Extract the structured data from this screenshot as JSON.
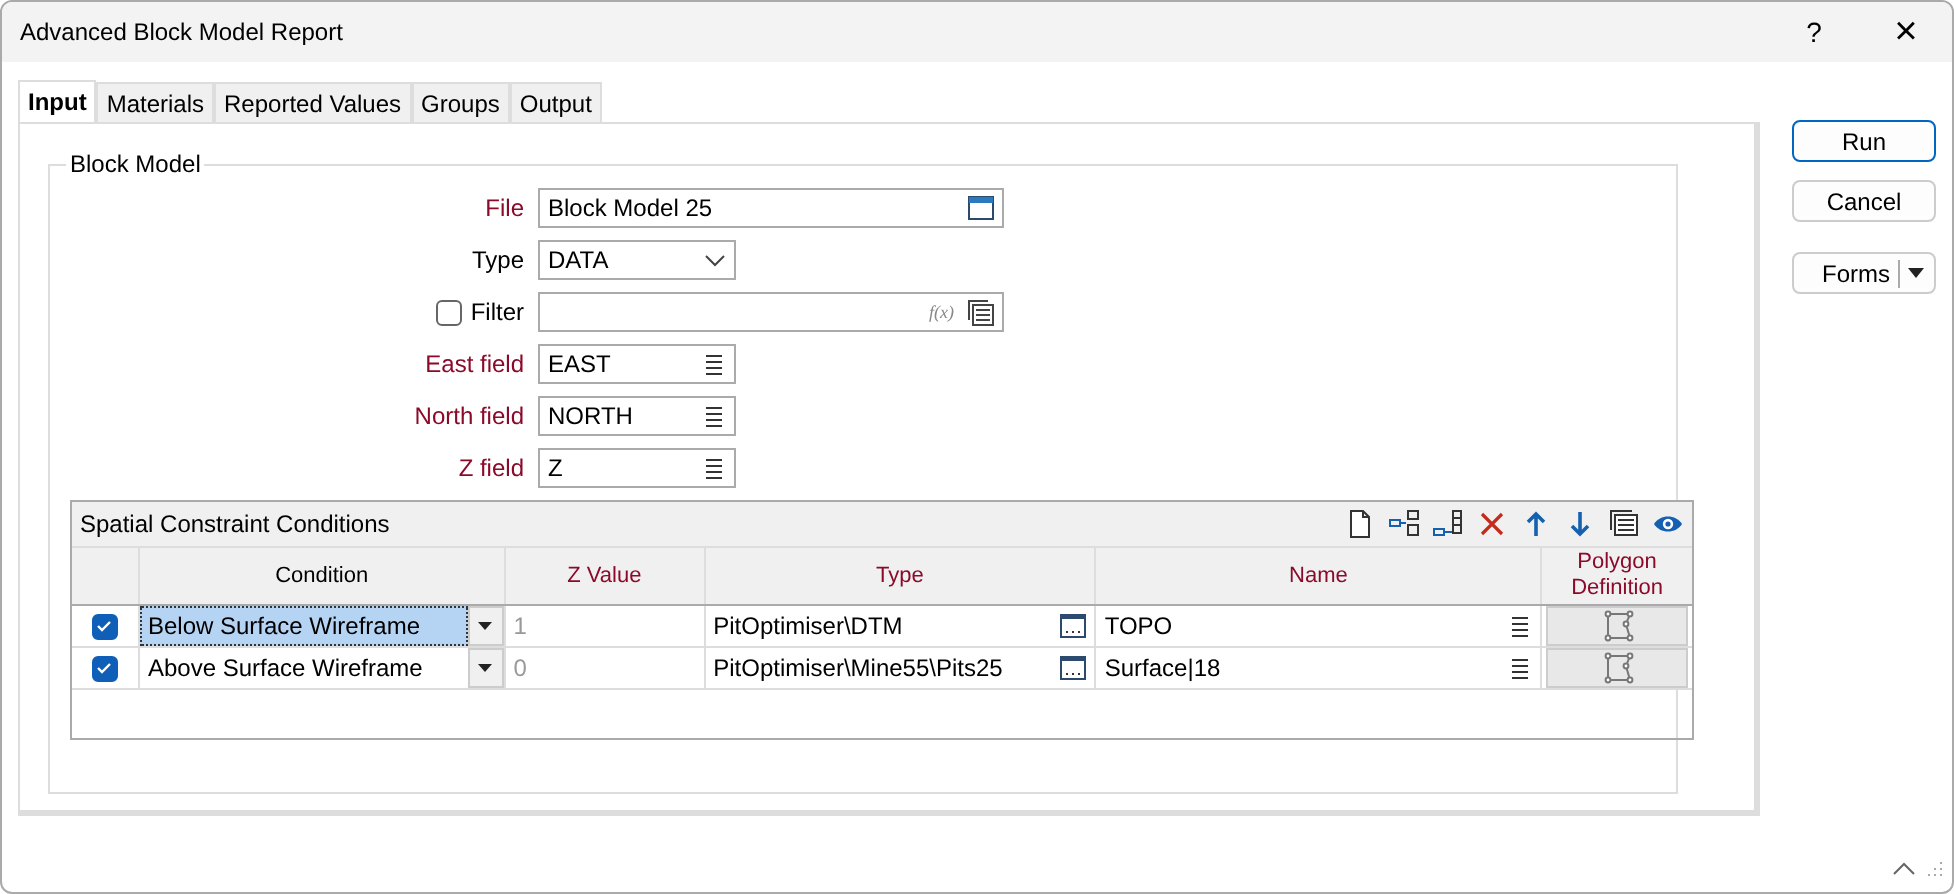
{
  "window": {
    "title": "Advanced Block Model Report",
    "help": "?",
    "close": "×"
  },
  "tabs": [
    {
      "label": "Input",
      "selected": true
    },
    {
      "label": "Materials",
      "selected": false
    },
    {
      "label": "Reported Values",
      "selected": false
    },
    {
      "label": "Groups",
      "selected": false
    },
    {
      "label": "Output",
      "selected": false
    }
  ],
  "group": {
    "title": "Block Model",
    "fields": [
      {
        "kind": "file",
        "label": "File",
        "required": true,
        "value": "Block Model 25"
      },
      {
        "kind": "select",
        "label": "Type",
        "required": false,
        "value": "DATA"
      },
      {
        "kind": "filter",
        "label": "Filter",
        "required": false,
        "checked": false,
        "fx": "f(x)"
      },
      {
        "kind": "column",
        "label": "East field",
        "required": true,
        "value": "EAST"
      },
      {
        "kind": "column",
        "label": "North field",
        "required": true,
        "value": "NORTH"
      },
      {
        "kind": "column",
        "label": "Z field",
        "required": true,
        "value": "Z"
      }
    ]
  },
  "grid": {
    "title": "Spatial Constraint Conditions",
    "columns": [
      {
        "label": "Condition",
        "required": false
      },
      {
        "label": "Z Value",
        "required": true
      },
      {
        "label": "Type",
        "required": true
      },
      {
        "label": "Name",
        "required": true
      },
      {
        "label": "Polygon Definition",
        "required": true
      }
    ],
    "rows": [
      {
        "checked": true,
        "selected": true,
        "condition": "Below Surface Wireframe",
        "z_value": "1",
        "type": "PitOptimiser\\DTM",
        "name": "TOPO"
      },
      {
        "checked": true,
        "selected": false,
        "condition": "Above Surface Wireframe",
        "z_value": "0",
        "type": "PitOptimiser\\Mine55\\Pits25",
        "name": "Surface|18"
      }
    ]
  },
  "buttons": [
    {
      "kind": "primary",
      "label": "Run"
    },
    {
      "kind": "plain",
      "label": "Cancel"
    },
    {
      "kind": "split",
      "label": "Forms"
    }
  ]
}
